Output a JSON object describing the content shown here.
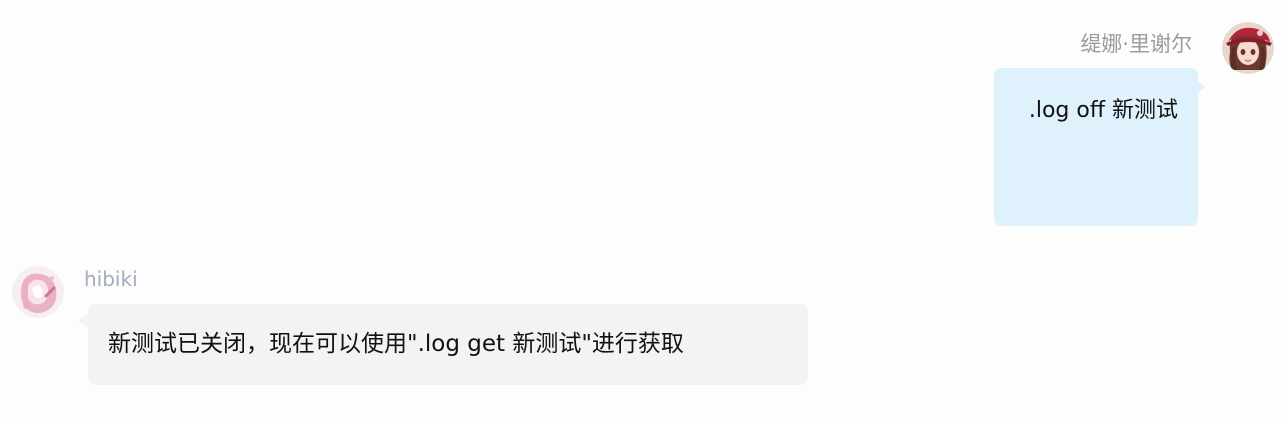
{
  "messages": [
    {
      "direction": "outgoing",
      "sender": "缇娜·里谢尔",
      "avatar": "anime-girl-red-hat-avatar",
      "text": ".log off 新测试",
      "bubble_color": "#dff1fd"
    },
    {
      "direction": "incoming",
      "sender": "hibiki",
      "avatar": "pink-watercolor-avatar",
      "text": "新测试已关闭，现在可以使用\".log get 新测试\"进行获取",
      "bubble_color": "#f3f3f3"
    }
  ],
  "colors": {
    "background": "#fdfdfd",
    "outgoing_sender": "#9b9b9b",
    "incoming_sender": "#a4abc0"
  }
}
